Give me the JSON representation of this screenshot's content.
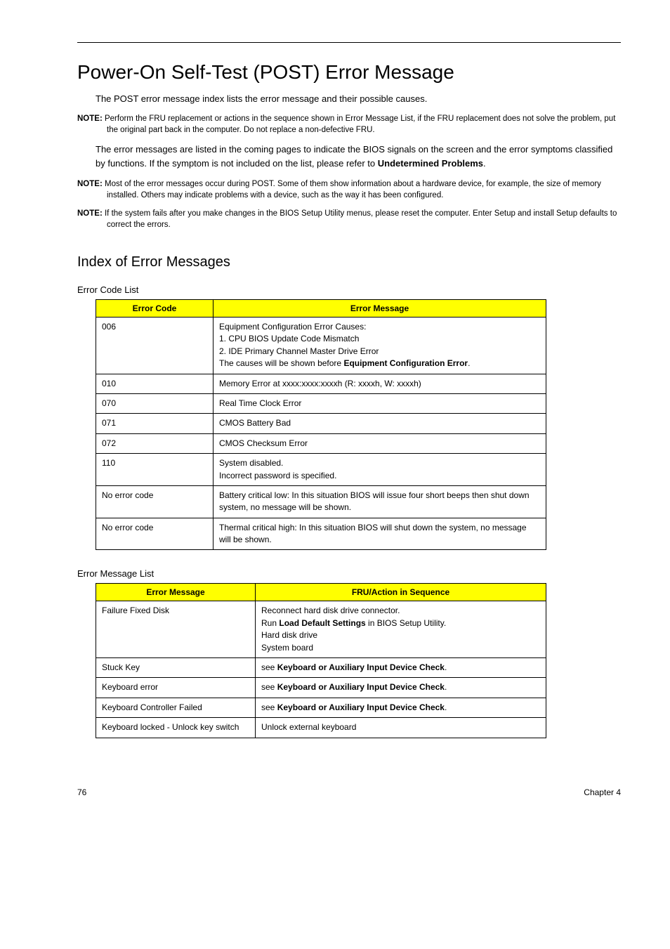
{
  "title": "Power-On Self-Test (POST) Error Message",
  "intro": "The POST error message index lists the error message and their possible causes.",
  "note1": {
    "label": "NOTE:",
    "text": "Perform the FRU replacement or actions in the sequence shown in Error Message List, if the FRU replacement does not solve the problem, put the original part back in the computer. Do not replace a non-defective FRU."
  },
  "para2_a": "The error messages are listed in the coming pages to indicate the BIOS signals on the screen and the error symptoms classified by functions. If the symptom is not included on the list, please refer to ",
  "para2_bold": "Undetermined Problems",
  "para2_b": ".",
  "note2": {
    "label": "NOTE:",
    "text": "Most of the error messages occur during POST. Some of them show information about a hardware device, for example, the size of memory installed. Others may indicate problems with a device, such as the way it has been configured."
  },
  "note3": {
    "label": "NOTE:",
    "text": "If the system fails after you make changes in the BIOS Setup Utility menus, please reset the computer. Enter Setup and install Setup defaults to correct the errors."
  },
  "subhead": "Index of Error Messages",
  "table1": {
    "caption": "Error Code List",
    "headers": [
      "Error Code",
      "Error Message"
    ],
    "rows": [
      {
        "code": "006",
        "lines": [
          "Equipment Configuration Error Causes:",
          "1. CPU BIOS Update Code Mismatch",
          "2. IDE Primary Channel Master Drive Error"
        ],
        "line4_a": "The causes will be shown before ",
        "line4_bold": "Equipment Configuration Error",
        "line4_b": "."
      },
      {
        "code": "010",
        "msg": "Memory Error at xxxx:xxxx:xxxxh (R: xxxxh, W: xxxxh)"
      },
      {
        "code": "070",
        "msg": "Real Time Clock Error"
      },
      {
        "code": "071",
        "msg": "CMOS Battery Bad"
      },
      {
        "code": "072",
        "msg": "CMOS Checksum Error"
      },
      {
        "code": "110",
        "lines": [
          "System disabled.",
          "Incorrect password is specified."
        ]
      },
      {
        "code": "No error code",
        "msg": "Battery critical low: In this situation BIOS will issue four short beeps then shut down system, no message will be shown."
      },
      {
        "code": "No error code",
        "msg": "Thermal critical high: In this situation BIOS will shut down the system, no message will be shown."
      }
    ]
  },
  "table2": {
    "caption": "Error Message List",
    "headers": [
      "Error Message",
      "FRU/Action in Sequence"
    ],
    "rows": [
      {
        "msg": "Failure Fixed Disk",
        "lines": [
          "Reconnect hard disk drive connector."
        ],
        "line2_a": "Run ",
        "line2_bold": "Load Default Settings",
        "line2_b": " in BIOS Setup Utility.",
        "lines_after": [
          "Hard disk drive",
          "System board"
        ]
      },
      {
        "msg": "Stuck Key",
        "action_a": "see ",
        "action_bold": "Keyboard or Auxiliary Input Device Check",
        "action_b": "."
      },
      {
        "msg": "Keyboard error",
        "action_a": "see ",
        "action_bold": "Keyboard or Auxiliary Input Device Check",
        "action_b": "."
      },
      {
        "msg": "Keyboard Controller Failed",
        "action_a": "see ",
        "action_bold": "Keyboard or Auxiliary Input Device Check",
        "action_b": "."
      },
      {
        "msg": "Keyboard locked - Unlock key switch",
        "action": "Unlock external keyboard"
      }
    ]
  },
  "footer": {
    "left": "76",
    "right": "Chapter 4"
  }
}
